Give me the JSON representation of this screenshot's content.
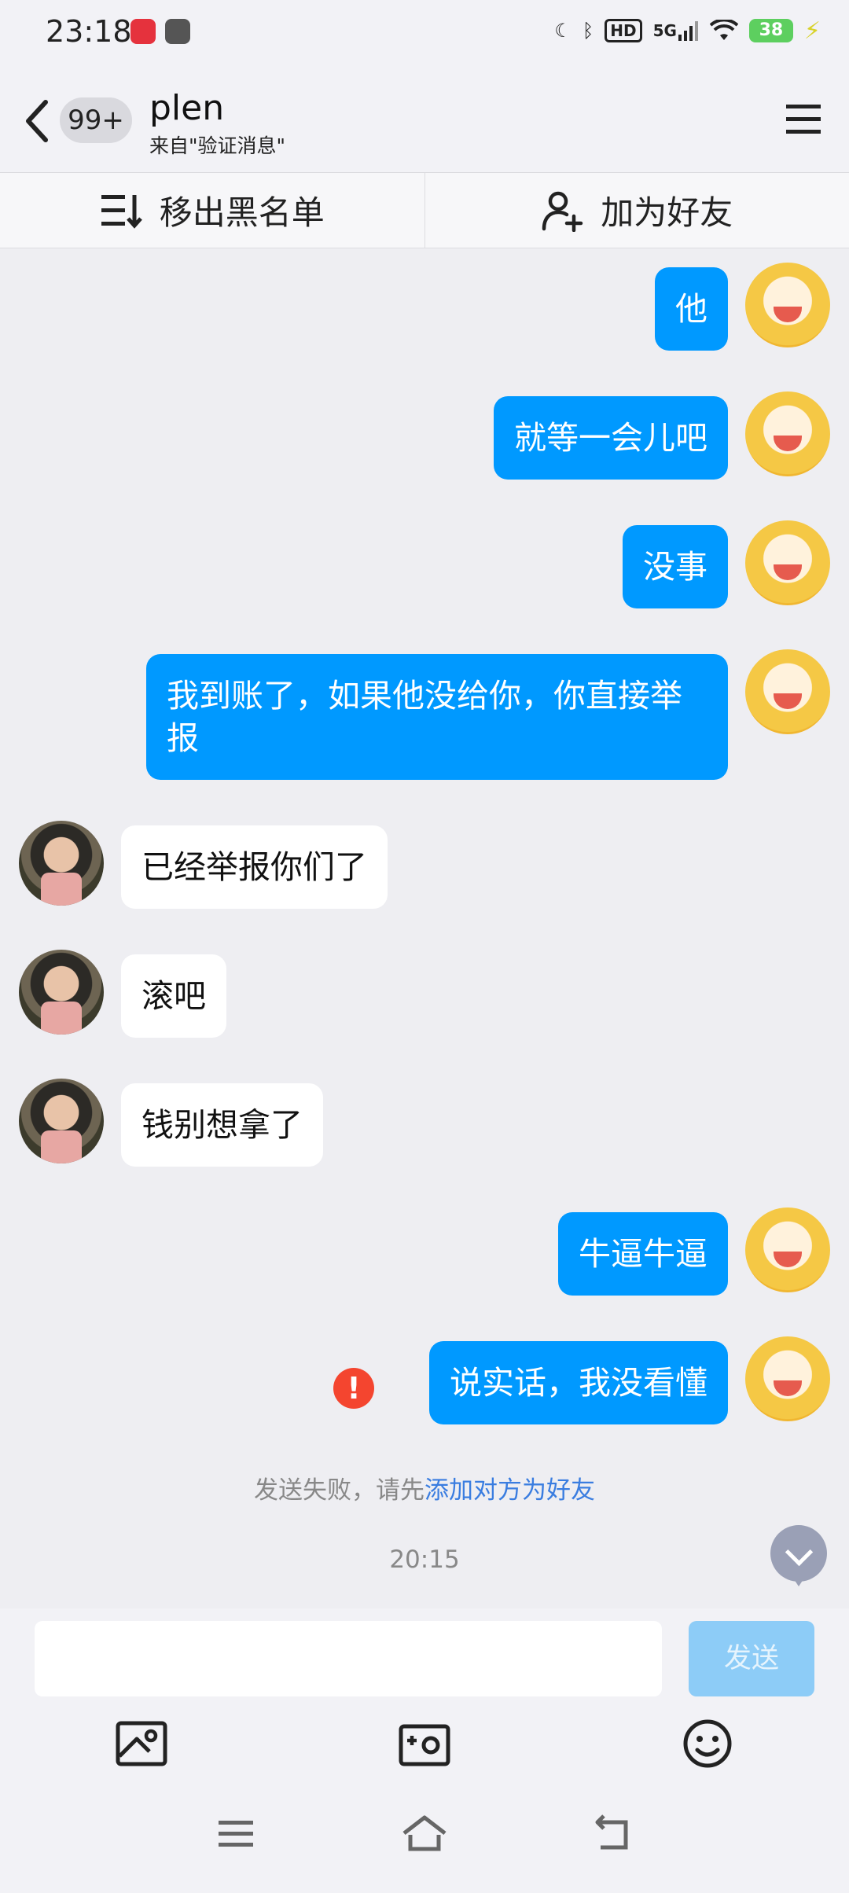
{
  "status_bar": {
    "time": "23:18",
    "network": "5G",
    "hd": "HD",
    "battery": "38"
  },
  "header": {
    "unread_badge": "99+",
    "contact_name": "plen",
    "contact_source": "来自\"验证消息\""
  },
  "actions": {
    "remove_blacklist": "移出黑名单",
    "add_friend": "加为好友"
  },
  "messages": [
    {
      "from": "me",
      "text": "他"
    },
    {
      "from": "me",
      "text": "就等一会儿吧"
    },
    {
      "from": "me",
      "text": "没事"
    },
    {
      "from": "me",
      "text": "我到账了，如果他没给你，你直接举报"
    },
    {
      "from": "peer",
      "text": "已经举报你们了"
    },
    {
      "from": "peer",
      "text": "滚吧"
    },
    {
      "from": "peer",
      "text": "钱别想拿了"
    },
    {
      "from": "me",
      "text": "牛逼牛逼"
    },
    {
      "from": "me",
      "text": "说实话，我没看懂",
      "failed": true
    }
  ],
  "send_failed": {
    "text": "发送失败，请先",
    "link": "添加对方为好友"
  },
  "time_separator": "20:15",
  "composer": {
    "value": "",
    "send_label": "发送"
  },
  "colors": {
    "outgoing_bubble": "#0099ff",
    "incoming_bubble": "#ffffff",
    "error": "#f4452f",
    "link": "#3a7de0"
  }
}
